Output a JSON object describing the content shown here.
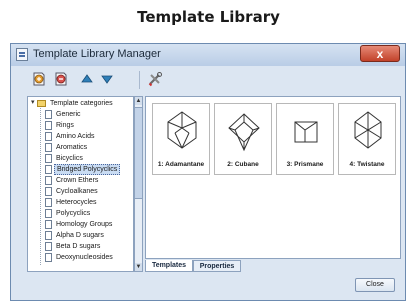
{
  "caption": "Template Library",
  "window": {
    "title": "Template Library Manager",
    "close_glyph": "x"
  },
  "toolbar": {
    "buttons": [
      {
        "icon": "template-add-icon"
      },
      {
        "icon": "template-remove-icon"
      },
      {
        "icon": "move-up-icon"
      },
      {
        "icon": "move-down-icon"
      },
      {
        "icon": "tools-icon"
      }
    ]
  },
  "tree": {
    "root_label": "Template categories",
    "items": [
      "Generic",
      "Rings",
      "Amino Acids",
      "Aromatics",
      "Bicyclics",
      "Bridged Polycyclics",
      "Crown Ethers",
      "Cycloalkanes",
      "Heterocycles",
      "Polycyclics",
      "Homology Groups",
      "Alpha D sugars",
      "Beta D sugars",
      "Deoxynucleosides"
    ],
    "selected_index": 5
  },
  "templates": [
    {
      "label": "1: Adamantane",
      "icon": "adamantane-structure-icon"
    },
    {
      "label": "2: Cubane",
      "icon": "cubane-structure-icon"
    },
    {
      "label": "3: Prismane",
      "icon": "prismane-structure-icon"
    },
    {
      "label": "4: Twistane",
      "icon": "twistane-structure-icon"
    }
  ],
  "tabs": [
    "Templates",
    "Properties"
  ],
  "active_tab": 0,
  "footer": {
    "close_label": "Close"
  },
  "colors": {
    "window_bg": "#dce6f2",
    "title_close": "#c2422a",
    "selection": "#c9dcf3"
  }
}
